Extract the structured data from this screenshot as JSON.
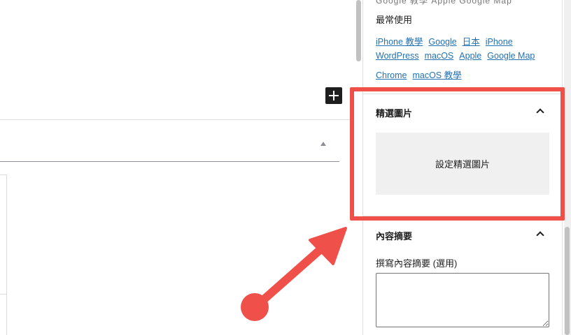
{
  "sidebar": {
    "top_cropped_text": "Google 教學  Apple  Google Map",
    "most_used_heading": "最常使用",
    "tags": [
      [
        "iPhone 教學",
        "Google",
        "日本",
        "iPhone"
      ],
      [
        "WordPress",
        "macOS",
        "Apple",
        "Google Map"
      ],
      [
        "Chrome",
        "macOS 教學"
      ]
    ],
    "featured_image": {
      "title": "精選圖片",
      "button_label": "設定精選圖片"
    },
    "excerpt": {
      "title": "內容摘要",
      "label": "撰寫內容摘要 (選用)",
      "value": ""
    }
  },
  "colors": {
    "annotation": "#f0504a",
    "link": "#2271b1",
    "button_bg": "#f0f0f0",
    "dark": "#1e1e1e"
  },
  "icons": {
    "add_block": "plus-icon",
    "panel_toggle": "chevron-up-icon",
    "collapse": "caret-up-icon"
  }
}
